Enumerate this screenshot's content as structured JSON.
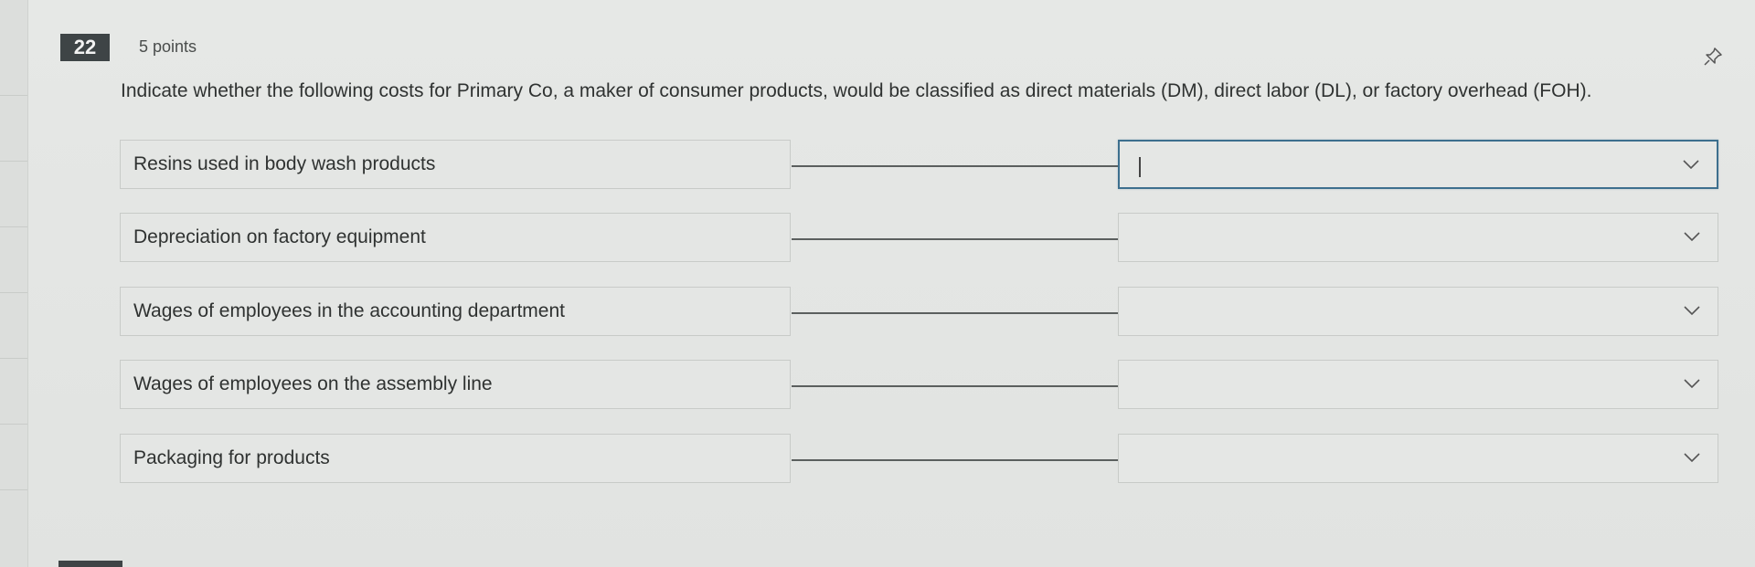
{
  "question": {
    "number": "22",
    "points": "5 points",
    "prompt": "Indicate whether the following costs for Primary Co, a maker of consumer products, would be classified as direct materials (DM), direct labor (DL), or factory overhead (FOH)."
  },
  "items": [
    {
      "label": "Resins used in body wash products",
      "selected": ""
    },
    {
      "label": "Depreciation on factory equipment",
      "selected": ""
    },
    {
      "label": "Wages of employees in the accounting department",
      "selected": ""
    },
    {
      "label": "Wages of employees on the assembly line",
      "selected": ""
    },
    {
      "label": "Packaging for products",
      "selected": ""
    }
  ],
  "icons": {
    "pin": "pin-icon",
    "dropdown": "chevron-down-icon"
  },
  "colors": {
    "number_badge": "#3e4446",
    "active_border": "#3d6f8e"
  }
}
